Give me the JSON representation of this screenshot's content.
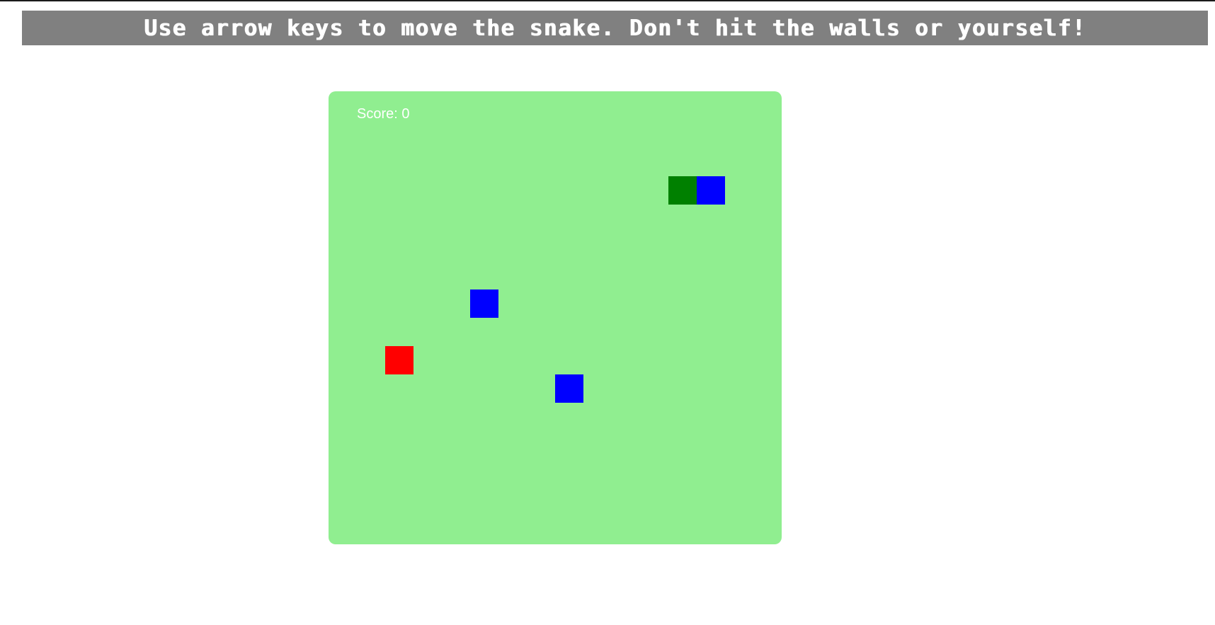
{
  "instructions": "Use arrow keys to move the snake. Don't hit the walls or yourself!",
  "score": {
    "label": "Score: 0",
    "value": 0
  },
  "grid": {
    "columns": 16,
    "rows": 16
  },
  "snake": [
    {
      "col": 12,
      "row": 3
    }
  ],
  "food": {
    "col": 2,
    "row": 9
  },
  "obstacles": [
    {
      "col": 13,
      "row": 3
    },
    {
      "col": 5,
      "row": 7
    },
    {
      "col": 8,
      "row": 10
    }
  ],
  "colors": {
    "banner_bg": "#808080",
    "banner_text": "#ffffff",
    "board_bg": "#90EE90",
    "snake": "#008000",
    "food": "#FF0000",
    "obstacle": "#0000FF",
    "score_text": "#ffffff"
  }
}
